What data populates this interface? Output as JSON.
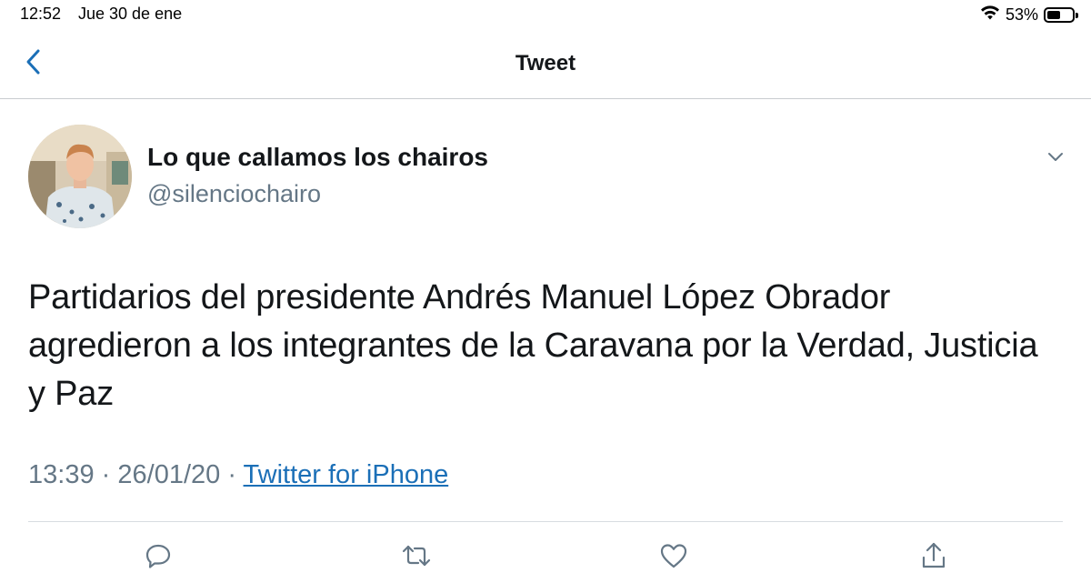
{
  "status_bar": {
    "time": "12:52",
    "date": "Jue 30 de ene",
    "battery_percent": "53%",
    "battery_level": 0.53,
    "icons": [
      "wifi-icon",
      "battery-icon"
    ]
  },
  "nav": {
    "title": "Tweet",
    "back_icon": "chevron-left-icon"
  },
  "tweet": {
    "author_name": "Lo que callamos los chairos",
    "author_handle": "@silenciochairo",
    "text": "Partidarios del presidente Andrés Manuel López Obrador agredieron a los integrantes de la Caravana por la Verdad, Justicia y Paz",
    "time": "13:39",
    "date": "26/01/20",
    "separator": "·",
    "source": "Twitter for iPhone"
  },
  "actions": {
    "icons": [
      "reply-icon",
      "retweet-icon",
      "like-icon",
      "share-icon"
    ]
  },
  "colors": {
    "accent": "#1b6fb7",
    "text_primary": "#14171a",
    "text_secondary": "#657786",
    "icon": "#657786",
    "divider": "#d8dce0"
  }
}
